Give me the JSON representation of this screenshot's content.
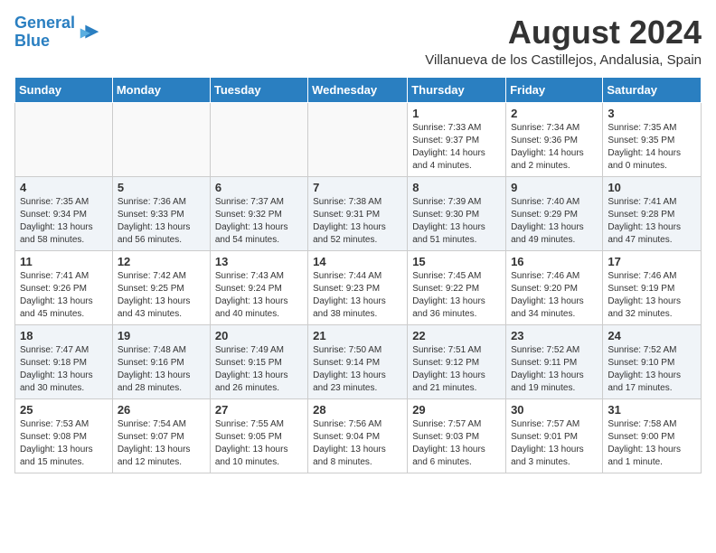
{
  "header": {
    "logo_line1": "General",
    "logo_line2": "Blue",
    "title": "August 2024",
    "subtitle": "Villanueva de los Castillejos, Andalusia, Spain"
  },
  "weekdays": [
    "Sunday",
    "Monday",
    "Tuesday",
    "Wednesday",
    "Thursday",
    "Friday",
    "Saturday"
  ],
  "weeks": [
    [
      {
        "day": "",
        "info": ""
      },
      {
        "day": "",
        "info": ""
      },
      {
        "day": "",
        "info": ""
      },
      {
        "day": "",
        "info": ""
      },
      {
        "day": "1",
        "info": "Sunrise: 7:33 AM\nSunset: 9:37 PM\nDaylight: 14 hours\nand 4 minutes."
      },
      {
        "day": "2",
        "info": "Sunrise: 7:34 AM\nSunset: 9:36 PM\nDaylight: 14 hours\nand 2 minutes."
      },
      {
        "day": "3",
        "info": "Sunrise: 7:35 AM\nSunset: 9:35 PM\nDaylight: 14 hours\nand 0 minutes."
      }
    ],
    [
      {
        "day": "4",
        "info": "Sunrise: 7:35 AM\nSunset: 9:34 PM\nDaylight: 13 hours\nand 58 minutes."
      },
      {
        "day": "5",
        "info": "Sunrise: 7:36 AM\nSunset: 9:33 PM\nDaylight: 13 hours\nand 56 minutes."
      },
      {
        "day": "6",
        "info": "Sunrise: 7:37 AM\nSunset: 9:32 PM\nDaylight: 13 hours\nand 54 minutes."
      },
      {
        "day": "7",
        "info": "Sunrise: 7:38 AM\nSunset: 9:31 PM\nDaylight: 13 hours\nand 52 minutes."
      },
      {
        "day": "8",
        "info": "Sunrise: 7:39 AM\nSunset: 9:30 PM\nDaylight: 13 hours\nand 51 minutes."
      },
      {
        "day": "9",
        "info": "Sunrise: 7:40 AM\nSunset: 9:29 PM\nDaylight: 13 hours\nand 49 minutes."
      },
      {
        "day": "10",
        "info": "Sunrise: 7:41 AM\nSunset: 9:28 PM\nDaylight: 13 hours\nand 47 minutes."
      }
    ],
    [
      {
        "day": "11",
        "info": "Sunrise: 7:41 AM\nSunset: 9:26 PM\nDaylight: 13 hours\nand 45 minutes."
      },
      {
        "day": "12",
        "info": "Sunrise: 7:42 AM\nSunset: 9:25 PM\nDaylight: 13 hours\nand 43 minutes."
      },
      {
        "day": "13",
        "info": "Sunrise: 7:43 AM\nSunset: 9:24 PM\nDaylight: 13 hours\nand 40 minutes."
      },
      {
        "day": "14",
        "info": "Sunrise: 7:44 AM\nSunset: 9:23 PM\nDaylight: 13 hours\nand 38 minutes."
      },
      {
        "day": "15",
        "info": "Sunrise: 7:45 AM\nSunset: 9:22 PM\nDaylight: 13 hours\nand 36 minutes."
      },
      {
        "day": "16",
        "info": "Sunrise: 7:46 AM\nSunset: 9:20 PM\nDaylight: 13 hours\nand 34 minutes."
      },
      {
        "day": "17",
        "info": "Sunrise: 7:46 AM\nSunset: 9:19 PM\nDaylight: 13 hours\nand 32 minutes."
      }
    ],
    [
      {
        "day": "18",
        "info": "Sunrise: 7:47 AM\nSunset: 9:18 PM\nDaylight: 13 hours\nand 30 minutes."
      },
      {
        "day": "19",
        "info": "Sunrise: 7:48 AM\nSunset: 9:16 PM\nDaylight: 13 hours\nand 28 minutes."
      },
      {
        "day": "20",
        "info": "Sunrise: 7:49 AM\nSunset: 9:15 PM\nDaylight: 13 hours\nand 26 minutes."
      },
      {
        "day": "21",
        "info": "Sunrise: 7:50 AM\nSunset: 9:14 PM\nDaylight: 13 hours\nand 23 minutes."
      },
      {
        "day": "22",
        "info": "Sunrise: 7:51 AM\nSunset: 9:12 PM\nDaylight: 13 hours\nand 21 minutes."
      },
      {
        "day": "23",
        "info": "Sunrise: 7:52 AM\nSunset: 9:11 PM\nDaylight: 13 hours\nand 19 minutes."
      },
      {
        "day": "24",
        "info": "Sunrise: 7:52 AM\nSunset: 9:10 PM\nDaylight: 13 hours\nand 17 minutes."
      }
    ],
    [
      {
        "day": "25",
        "info": "Sunrise: 7:53 AM\nSunset: 9:08 PM\nDaylight: 13 hours\nand 15 minutes."
      },
      {
        "day": "26",
        "info": "Sunrise: 7:54 AM\nSunset: 9:07 PM\nDaylight: 13 hours\nand 12 minutes."
      },
      {
        "day": "27",
        "info": "Sunrise: 7:55 AM\nSunset: 9:05 PM\nDaylight: 13 hours\nand 10 minutes."
      },
      {
        "day": "28",
        "info": "Sunrise: 7:56 AM\nSunset: 9:04 PM\nDaylight: 13 hours\nand 8 minutes."
      },
      {
        "day": "29",
        "info": "Sunrise: 7:57 AM\nSunset: 9:03 PM\nDaylight: 13 hours\nand 6 minutes."
      },
      {
        "day": "30",
        "info": "Sunrise: 7:57 AM\nSunset: 9:01 PM\nDaylight: 13 hours\nand 3 minutes."
      },
      {
        "day": "31",
        "info": "Sunrise: 7:58 AM\nSunset: 9:00 PM\nDaylight: 13 hours\nand 1 minute."
      }
    ]
  ]
}
